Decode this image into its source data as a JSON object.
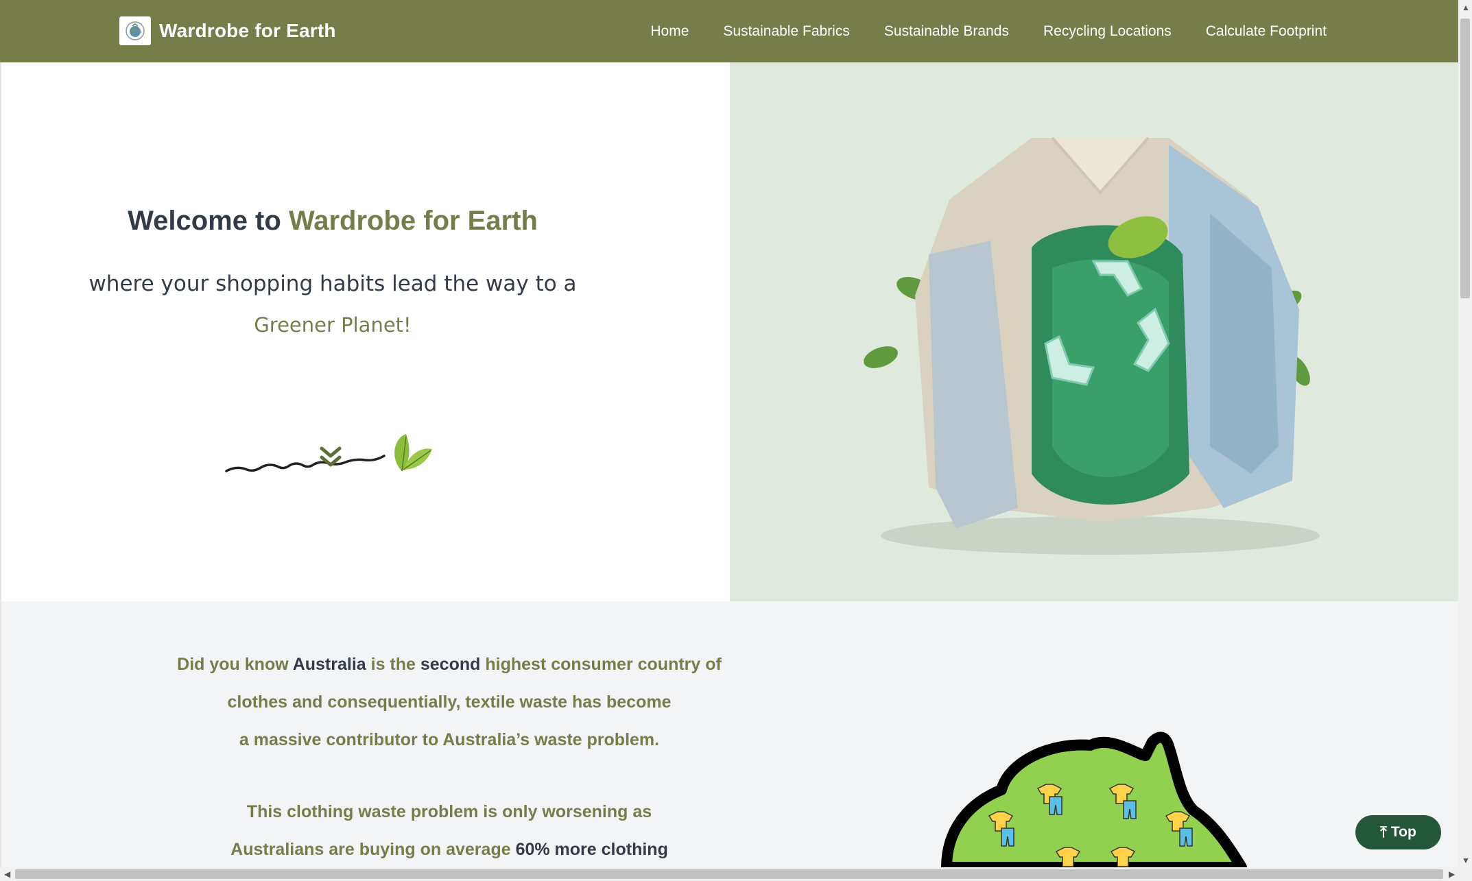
{
  "navbar": {
    "brand": "Wardrobe for Earth",
    "logo_icon": "recycle-globe-icon",
    "links": [
      "Home",
      "Sustainable Fabrics",
      "Sustainable Brands",
      "Recycling Locations",
      "Calculate Footprint"
    ],
    "color": "#767d4b"
  },
  "hero": {
    "title_prefix": "Welcome to",
    "title_accent": "Wardrobe for Earth",
    "subtitle": "where your shopping habits lead the way to a",
    "subtitle_accent": "Greener Planet!",
    "scroll_icon": "double-chevron-down-icon",
    "image": "recycled-clothing-illustration"
  },
  "facts": {
    "p1_a": "Did you know",
    "p1_b": "Australia",
    "p1_c": "is the",
    "p1_d": "second",
    "p1_e": "highest consumer country of",
    "p1_line2": "clothes and consequentially, textile waste has become",
    "p1_line3": "a massive contributor to Australia’s waste problem.",
    "p2_line1": "This clothing waste problem is only worsening as",
    "p2_a": "Australians are buying on average",
    "p2_b": "60% more clothing",
    "image": "australia-clothing-map"
  },
  "top_button": {
    "label": "Top",
    "icon": "arrow-up-to-line-icon",
    "color": "#24563a"
  }
}
